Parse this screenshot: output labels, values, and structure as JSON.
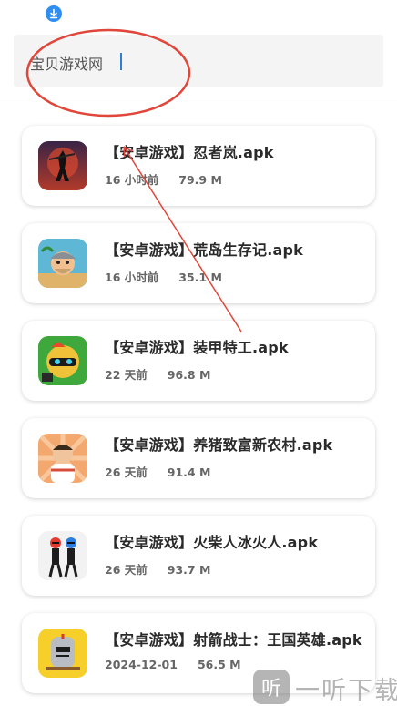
{
  "search": {
    "value": "宝贝游戏网"
  },
  "items": [
    {
      "title": "【安卓游戏】忍者岚.apk",
      "time": "16 小时前",
      "size": "79.9 M",
      "icon": "ninja-game-icon"
    },
    {
      "title": "【安卓游戏】荒岛生存记.apk",
      "time": "16 小时前",
      "size": "35.1 M",
      "icon": "island-survival-game-icon"
    },
    {
      "title": "【安卓游戏】装甲特工.apk",
      "time": "22 天前",
      "size": "96.8 M",
      "icon": "armored-agent-game-icon"
    },
    {
      "title": "【安卓游戏】养猪致富新农村.apk",
      "time": "26 天前",
      "size": "91.4 M",
      "icon": "pig-farm-game-icon"
    },
    {
      "title": "【安卓游戏】火柴人冰火人.apk",
      "time": "26 天前",
      "size": "93.7 M",
      "icon": "stickman-fire-ice-game-icon"
    },
    {
      "title": "【安卓游戏】射箭战士：王国英雄.apk",
      "time": "2024-12-01",
      "size": "56.5 M",
      "icon": "archer-warrior-game-icon"
    }
  ],
  "watermark": {
    "text": "一听下载",
    "logo_glyph": "听"
  },
  "colors": {
    "accent": "#2f8ff0",
    "annotation": "#e0463a"
  }
}
